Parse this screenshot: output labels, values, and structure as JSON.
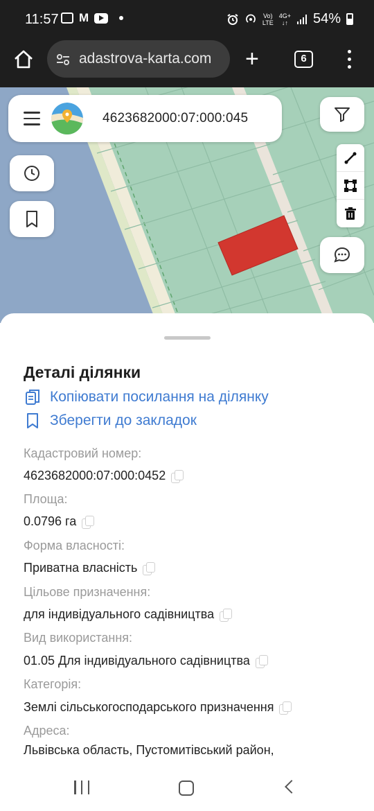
{
  "status_bar": {
    "time": "11:57",
    "network_top": "Vo)",
    "network_bottom": "LTE",
    "data_top": "4G+",
    "data_bottom": "↓↑",
    "battery": "54%"
  },
  "browser": {
    "url": "adastrova-karta.com",
    "tab_count": "6"
  },
  "map": {
    "search_value": "4623682000:07:000:045",
    "parcel_color": "#d2372f"
  },
  "details": {
    "title": "Деталі ділянки",
    "copy_link": "Копіювати посилання на ділянку",
    "save_bookmark": "Зберегти до закладок",
    "fields": [
      {
        "label": "Кадастровий номер:",
        "value": "4623682000:07:000:0452"
      },
      {
        "label": "Площа:",
        "value": "0.0796 га"
      },
      {
        "label": "Форма власності:",
        "value": "Приватна власність"
      },
      {
        "label": "Цільове призначення:",
        "value": "для індивідуального садівництва"
      },
      {
        "label": "Вид використання:",
        "value": "01.05 Для індивідуального садівництва"
      },
      {
        "label": "Категорія:",
        "value": "Землі сільськогосподарського призначення"
      },
      {
        "label": "Адреса:",
        "value": "Львівська область, Пустомитівський район,"
      }
    ]
  },
  "colors": {
    "link": "#3f7bd1",
    "map_green": "#a6d0b9",
    "map_water": "#8da6c7",
    "parcel": "#d2372f"
  }
}
